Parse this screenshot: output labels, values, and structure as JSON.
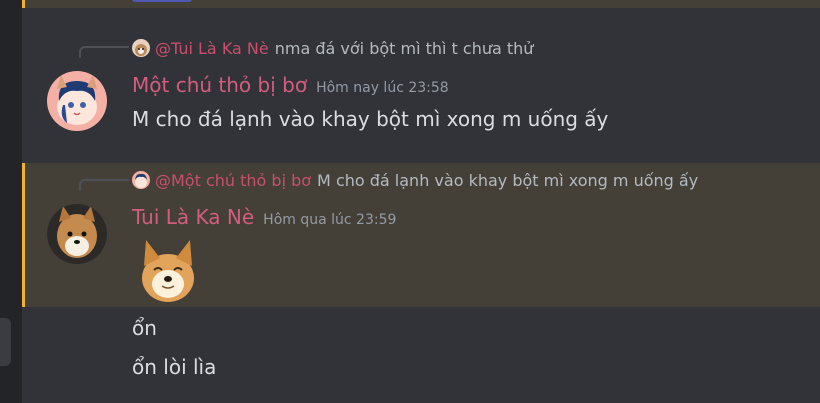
{
  "messages": [
    {
      "reply_to": {
        "author_mention": "@Tui Là Ka Nè",
        "text": "nma đá với bột mì thì t chưa thử"
      },
      "author": "Một chú thỏ bị bơ",
      "timestamp": "Hôm nay lúc 23:58",
      "text": "M cho đá lạnh vào khay bột mì xong m uống ấy"
    },
    {
      "reply_to": {
        "author_mention": "@Một chú thỏ bị bơ",
        "text": "M cho đá lạnh vào khay bột mì xong m uống ấy"
      },
      "author": "Tui Là Ka Nè",
      "timestamp": "Hôm qua lúc 23:59",
      "attachment": "shiba-doge-sticker"
    }
  ],
  "followups": [
    "ổn",
    "ổn lòi lìa"
  ],
  "colors": {
    "background": "#313338",
    "highlight": "#444038",
    "highlight_bar": "#f0b232",
    "username": "#d35d7e",
    "mention": "#c94f6d"
  }
}
